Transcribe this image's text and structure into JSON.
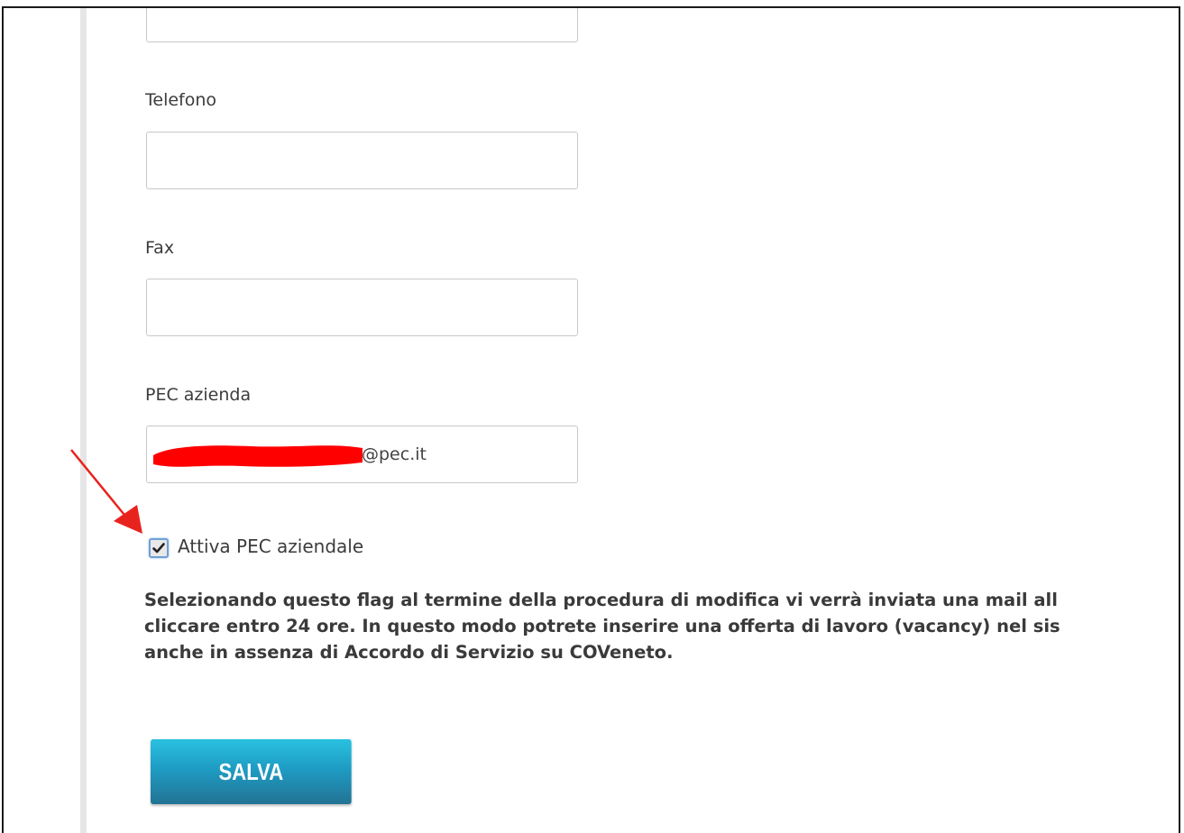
{
  "form": {
    "top_field_value": "",
    "telefono": {
      "label": "Telefono",
      "value": ""
    },
    "fax": {
      "label": "Fax",
      "value": ""
    },
    "pec": {
      "label": "PEC azienda",
      "value_suffix": "@pec.it"
    },
    "attiva_pec": {
      "label": "Attiva PEC aziendale",
      "checked": true
    },
    "info_lines": [
      "Selezionando questo flag al termine della procedura di modifica vi verrà inviata una mail all",
      "cliccare entro 24 ore. In questo modo potrete inserire una offerta di lavoro (vacancy) nel sis",
      "anche in assenza di Accordo di Servizio su COVeneto."
    ],
    "save_label": "SALVA"
  },
  "annotation": {
    "arrow_color": "#e8231e",
    "redaction_color": "#ff0000"
  },
  "colors": {
    "button_top": "#29c1e0",
    "button_bottom": "#237394",
    "checkbox_border": "#6fa0d8"
  }
}
